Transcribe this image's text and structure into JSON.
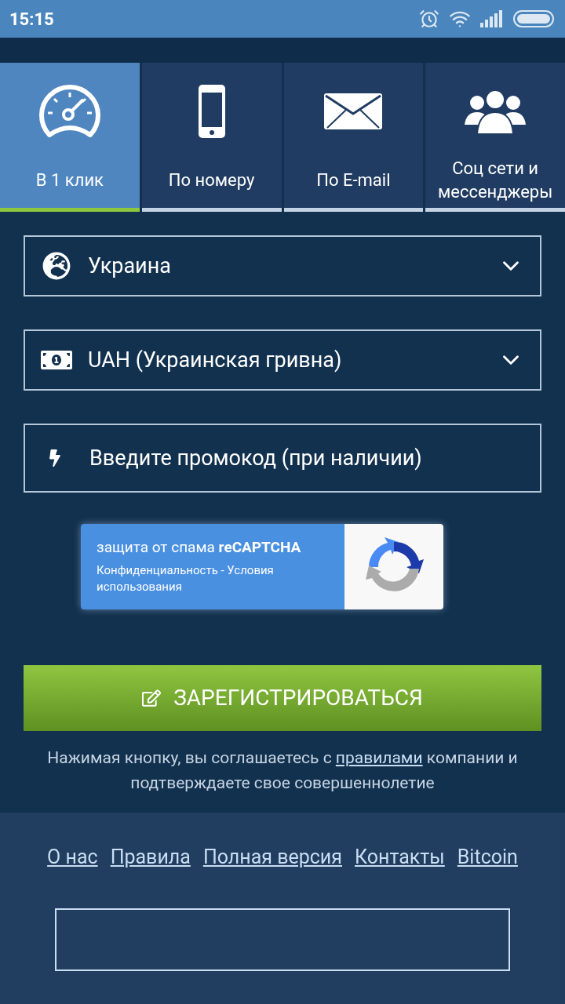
{
  "status_bar": {
    "time": "15:15"
  },
  "tabs": [
    {
      "label": "В 1 клик",
      "selected": true
    },
    {
      "label": "По номеру",
      "selected": false
    },
    {
      "label": "По E-mail",
      "selected": false
    },
    {
      "label": "Соц сети и мессенджеры",
      "selected": false
    }
  ],
  "fields": [
    {
      "kind": "select",
      "value": "Украина"
    },
    {
      "kind": "select",
      "value": "UAH (Украинская гривна)"
    },
    {
      "kind": "input",
      "placeholder": "Введите промокод (при наличии)"
    }
  ],
  "recaptcha": {
    "title": "защита от спама **reCAPTCHA**",
    "links": "Конфиденциальность - Условия использования"
  },
  "register_button": "ЗАРЕГИСТРИРОВАТЬСЯ",
  "agreement": {
    "before": "Нажимая кнопку, вы соглашаетесь с",
    "link": "правилами",
    "after": "компании и подтверждаете свое совершеннолетие"
  },
  "footer_links": [
    "О нас",
    "Правила",
    "Полная версия",
    "Контакты",
    "Bitcoin"
  ]
}
